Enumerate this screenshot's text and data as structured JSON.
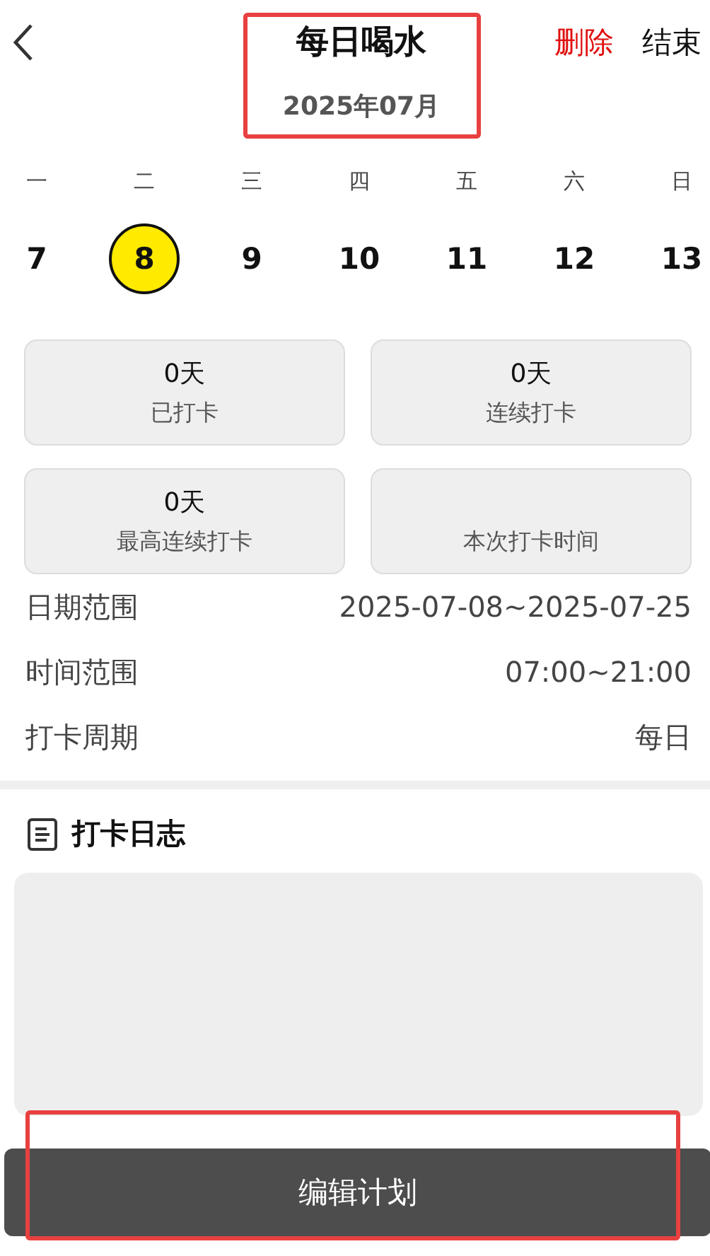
{
  "header": {
    "title": "每日喝水",
    "month": "2025年07月",
    "actions": [
      {
        "label": "删除",
        "kind": "danger"
      },
      {
        "label": "结束",
        "kind": "normal"
      }
    ]
  },
  "weekdays": [
    "一",
    "二",
    "三",
    "四",
    "五",
    "六",
    "日"
  ],
  "dates": [
    {
      "label": "7",
      "selected": false
    },
    {
      "label": "8",
      "selected": true
    },
    {
      "label": "9",
      "selected": false
    },
    {
      "label": "10",
      "selected": false
    },
    {
      "label": "11",
      "selected": false
    },
    {
      "label": "12",
      "selected": false
    },
    {
      "label": "13",
      "selected": false
    }
  ],
  "stats": [
    {
      "value": "0天",
      "label": "已打卡"
    },
    {
      "value": "0天",
      "label": "连续打卡"
    },
    {
      "value": "0天",
      "label": "最高连续打卡"
    },
    {
      "label": "本次打卡时间"
    }
  ],
  "info": [
    {
      "label": "日期范围",
      "value": "2025-07-08~2025-07-25"
    },
    {
      "label": "时间范围",
      "value": "07:00~21:00"
    },
    {
      "label": "打卡周期",
      "value": "每日"
    }
  ],
  "log": {
    "title": "打卡日志"
  },
  "button": {
    "label": "编辑计划"
  }
}
